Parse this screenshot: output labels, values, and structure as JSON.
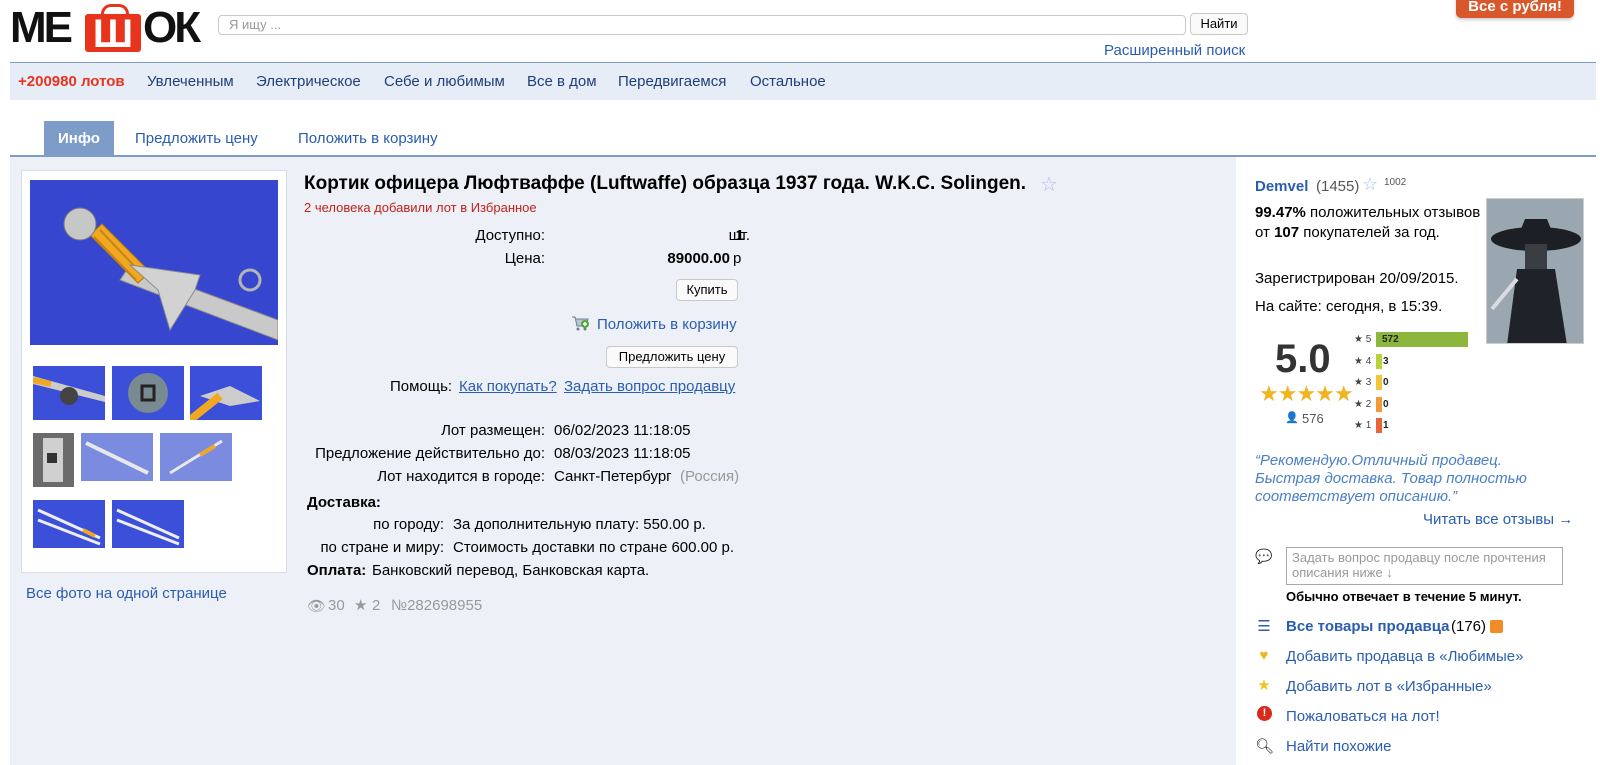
{
  "header": {
    "logo_text": "МЕШОК",
    "search_placeholder": "Я ищу ...",
    "search_button": "Найти",
    "advanced_search": "Расширенный поиск",
    "promo": "Все с рубля!"
  },
  "categories": {
    "lots": "+200980 лотов",
    "items": [
      "Увлеченным",
      "Электрическое",
      "Себе и любимым",
      "Все в дом",
      "Передвигаемся",
      "Остальное"
    ]
  },
  "tabs": [
    "Инфо",
    "Предложить цену",
    "Положить в корзину"
  ],
  "photos": {
    "all_photos_link": "Все фото на одной странице"
  },
  "lot": {
    "title": "Кортик офицера Люфтваффе (Luftwaffe) образца 1937 года. W.K.C. Solingen.",
    "favorites_note": "2 человека добавили лот в Избранное",
    "available_label": "Доступно:",
    "available_value": "1",
    "available_unit": "шт.",
    "price_label": "Цена:",
    "price_value": "89000.00",
    "price_unit": "р",
    "buy_button": "Купить",
    "cart_link": "Положить в корзину",
    "offer_button": "Предложить цену",
    "help_label": "Помощь:",
    "help_how": "Как покупать?",
    "help_ask": "Задать вопрос продавцу",
    "placed_label": "Лот размещен:",
    "placed_value": "06/02/2023 11:18:05",
    "valid_label": "Предложение действительно до:",
    "valid_value": "08/03/2023 11:18:05",
    "city_label": "Лот находится в городе:",
    "city_value": "Санкт-Петербург",
    "country_value": "(Россия)",
    "delivery_label": "Доставка:",
    "delivery_city_label": "по городу:",
    "delivery_city_value": "За дополнительную плату: 550.00 р.",
    "delivery_world_label": "по стране и миру:",
    "delivery_world_value": "Стоимость доставки по стране 600.00 р.",
    "payment_label": "Оплата:",
    "payment_value": "Банковский перевод, Банковская карта.",
    "views": "30",
    "stars": "2",
    "lot_number": "№282698955"
  },
  "seller": {
    "name": "Demvel",
    "count": "(1455)",
    "star_count": "1002",
    "positive_pct": "99.47%",
    "positive_text1": "положительных",
    "positive_text2": "отзывов от",
    "buyers": "107",
    "positive_text3": "покупателей за",
    "positive_text4": "год.",
    "registered": "Зарегистрирован 20/09/2015.",
    "online": "На сайте: сегодня, в 15:39.",
    "rating": "5.0",
    "reviewers": "576",
    "breakdown": [
      {
        "stars": "5",
        "count": "572",
        "fraction": 1.0,
        "color": "#8cb73c"
      },
      {
        "stars": "4",
        "count": "3",
        "fraction": 0.02,
        "color": "#b8d23a"
      },
      {
        "stars": "3",
        "count": "0",
        "fraction": 0.0,
        "color": "#f2c63a"
      },
      {
        "stars": "2",
        "count": "0",
        "fraction": 0.0,
        "color": "#f09a3a"
      },
      {
        "stars": "1",
        "count": "1",
        "fraction": 0.01,
        "color": "#e8623a"
      }
    ],
    "quote": "“Рекомендую.Отличный продавец. Быстрая доставка. Товар полностью соответствует описанию.”",
    "read_all": "Читать все отзывы →",
    "ask_placeholder": "Задать вопрос продавцу после прочтения описания ниже ↓",
    "reply_time": "Обычно отвечает в течение 5 минут.",
    "all_items": "Все товары продавца",
    "all_items_count": "(176)",
    "add_favorite_seller": "Добавить продавца в «Любимые»",
    "add_favorite_lot": "Добавить лот в «Избранные»",
    "report": "Пожаловаться на лот!",
    "find_similar": "Найти похожие"
  }
}
